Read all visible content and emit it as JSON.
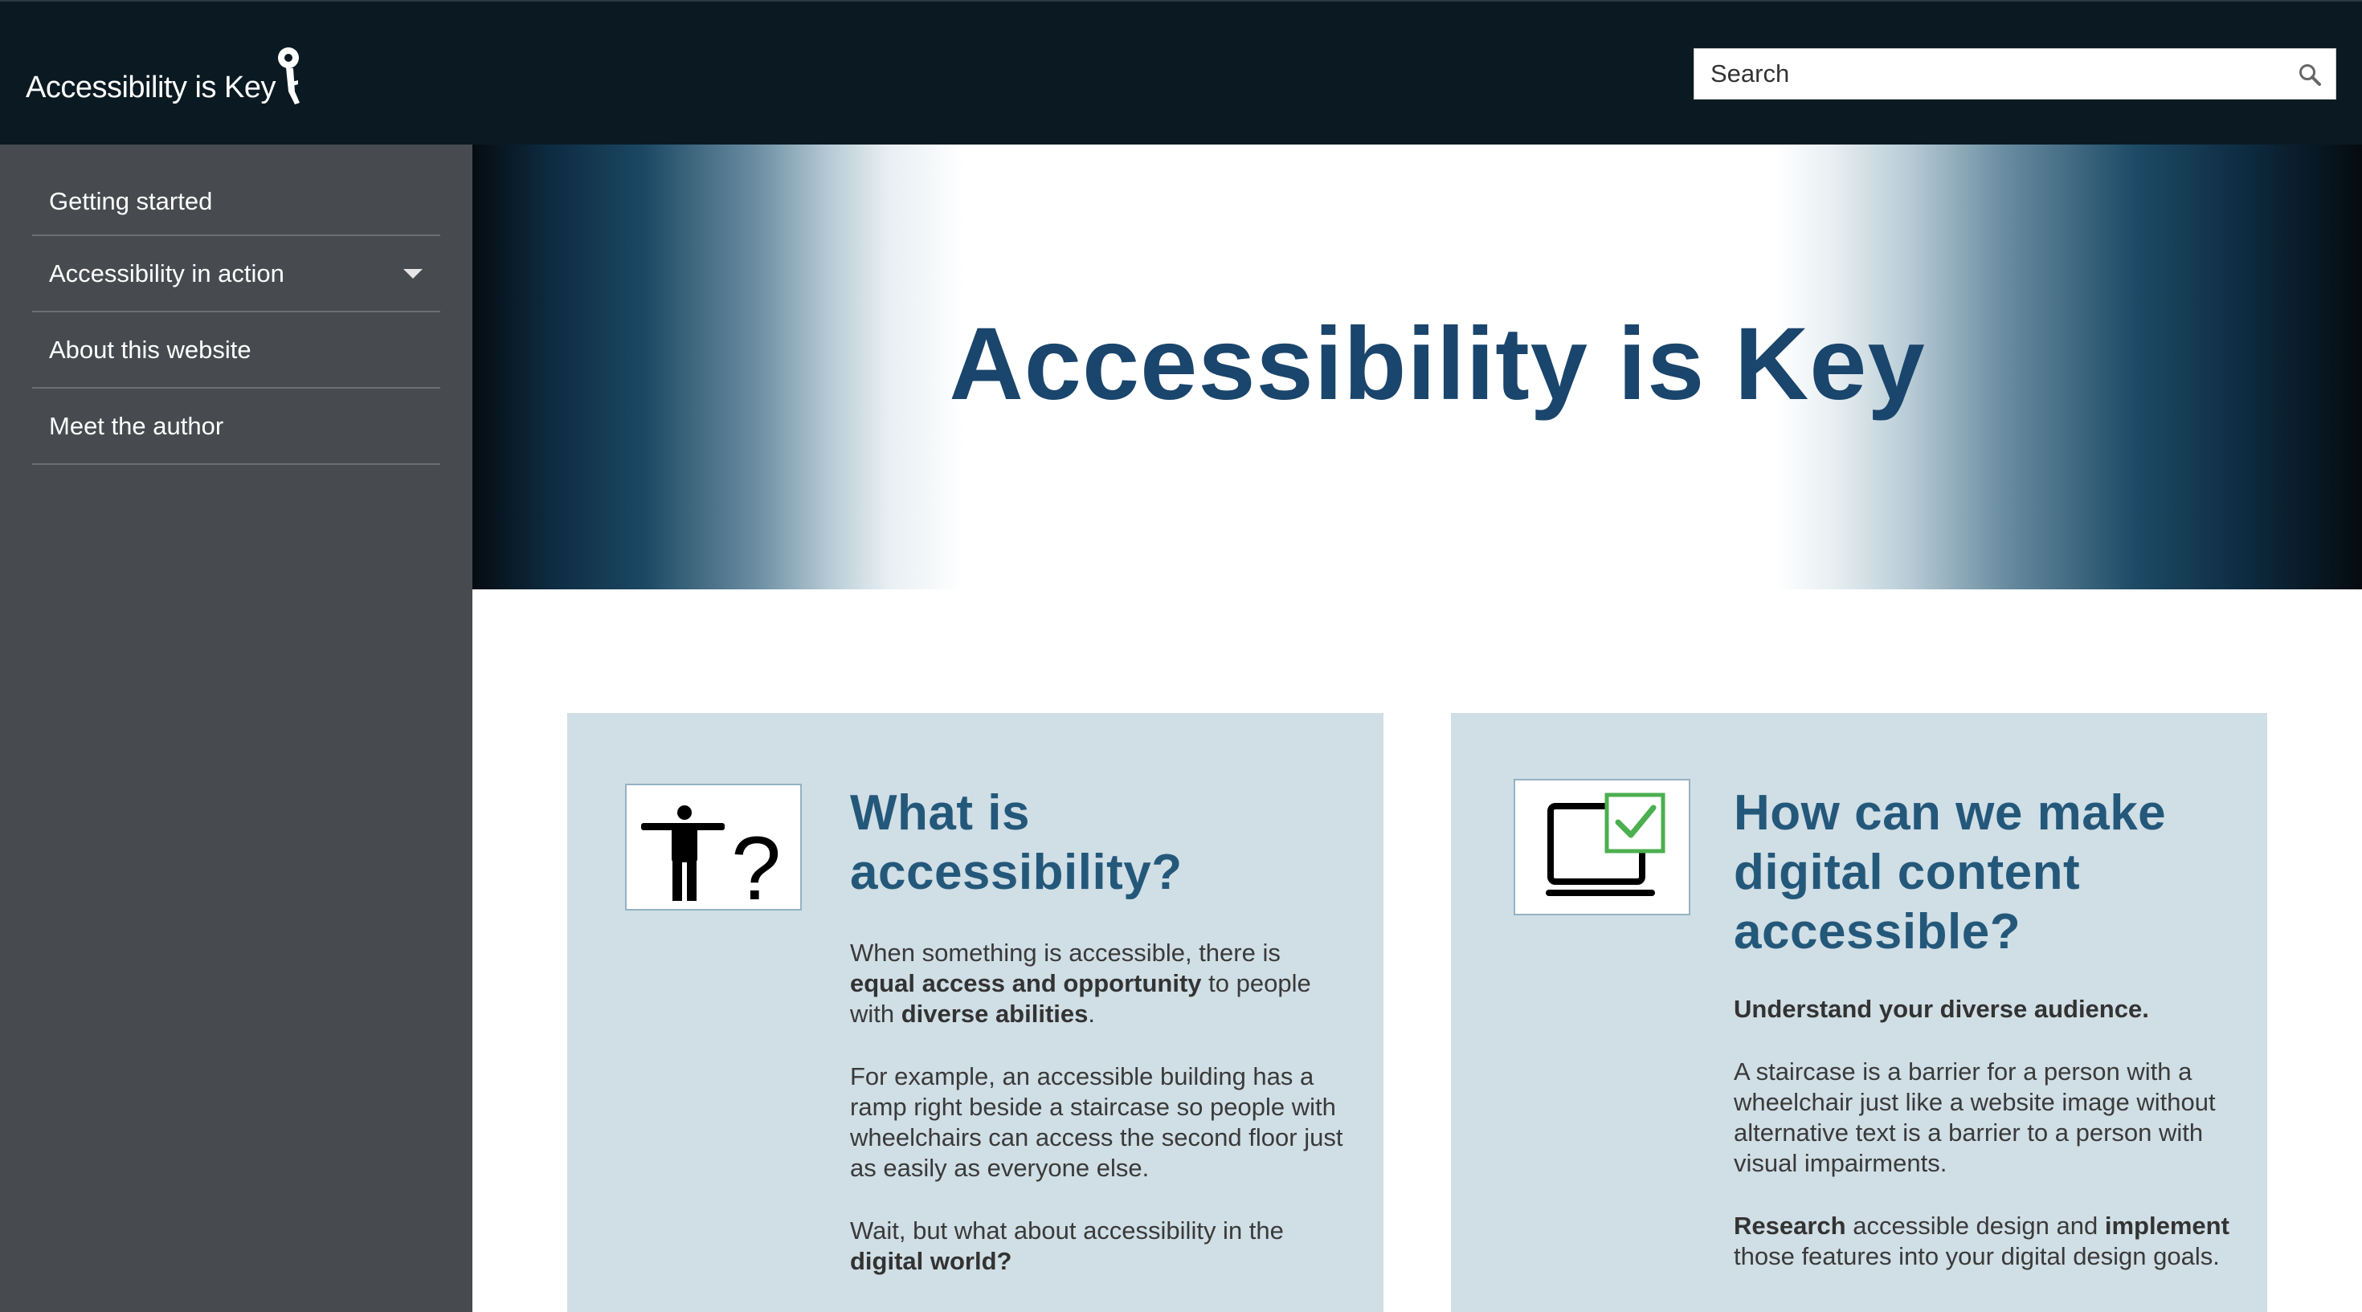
{
  "header": {
    "logo_text": "Accessibility is Key",
    "search_placeholder": "Search",
    "search_icon": "magnifier-icon"
  },
  "sidebar": {
    "items": [
      {
        "label": "Getting started"
      },
      {
        "label": "Accessibility in action",
        "has_dropdown": true
      },
      {
        "label": "About this website"
      },
      {
        "label": "Meet the author"
      }
    ]
  },
  "hero": {
    "title": "Accessibility is Key"
  },
  "cards": [
    {
      "icon": "person-question-icon",
      "title": "What is accessibility?",
      "p1_a": "When something is accessible, there is ",
      "p1_b": "equal access and opportunity",
      "p1_c": " to people with ",
      "p1_d": "diverse abilities",
      "p1_e": ".",
      "p2": "For example, an accessible building has a ramp right beside a staircase so people with wheelchairs can access the second floor just as easily as everyone else.",
      "p3_a": "Wait, but what about accessibility in the ",
      "p3_b": "digital world?"
    },
    {
      "icon": "laptop-check-icon",
      "title": "How can we make digital content accessible?",
      "lead": "Understand your diverse audience.",
      "p2": "A staircase is a barrier for a person with a wheelchair just like a website image without alternative text is a barrier to a person with visual impairments.",
      "p3_a": "Research",
      "p3_b": " accessible design and ",
      "p3_c": "implement",
      "p3_d": " those features into your digital design goals."
    }
  ],
  "colors": {
    "header_bg": "#0b1a22",
    "sidebar_bg": "#474b4f",
    "hero_title": "#1a456c",
    "card_bg": "#d0dee5",
    "card_title": "#24587a",
    "check_green": "#4caf50"
  }
}
